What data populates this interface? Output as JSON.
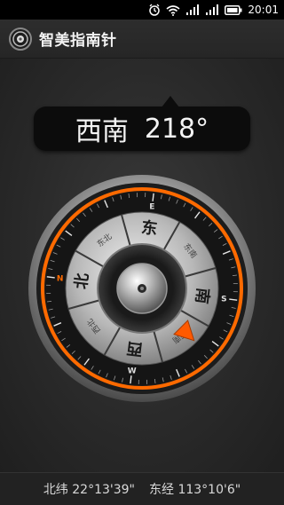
{
  "status_bar": {
    "time": "20:01",
    "icons": [
      "alarm-icon",
      "wifi-icon",
      "signal-icon",
      "signal-icon",
      "battery-icon"
    ]
  },
  "app": {
    "title": "智美指南针",
    "logo_icon": "compass-logo-icon"
  },
  "heading": {
    "direction": "西南",
    "degrees": "218°"
  },
  "compass": {
    "heading_degrees": 218,
    "cardinals": {
      "north": "北",
      "east": "东",
      "south": "南",
      "west": "西"
    },
    "intercardinals": {
      "northeast": "东北",
      "southeast": "东南",
      "southwest": "西南",
      "northwest": "西北"
    },
    "ring_letters": {
      "n": "N",
      "e": "E",
      "s": "S",
      "w": "W"
    },
    "accent_color": "#ff6a00",
    "pointer_color": "#ff5a00"
  },
  "location": {
    "latitude": "北纬 22°13'39\"",
    "longitude": "东经 113°10'6\""
  }
}
